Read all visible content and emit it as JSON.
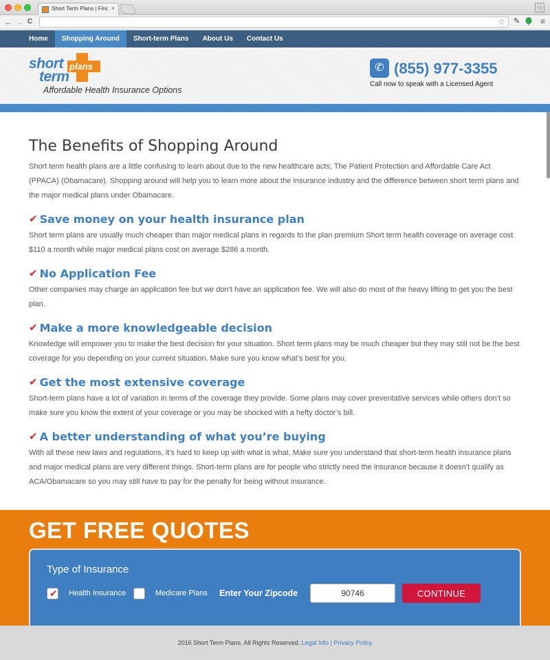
{
  "browser": {
    "tab_title": "Short Term Plans | Find the",
    "tab_close": "×",
    "back": "←",
    "forward": "→",
    "reload": "C",
    "star": "☆",
    "menu": "≡",
    "profile": "⚇"
  },
  "nav": {
    "items": [
      {
        "label": "Home"
      },
      {
        "label": "Shopping Around"
      },
      {
        "label": "Short-term Plans"
      },
      {
        "label": "About Us"
      },
      {
        "label": "Contact Us"
      }
    ],
    "active_index": 1
  },
  "header": {
    "logo_short": "short",
    "logo_term": "term",
    "logo_plans": "plans",
    "tagline": "Affordable Health Insurance Options",
    "phone_icon": "✆",
    "phone": "(855) 977-3355",
    "phone_caption": "Call now to speak with a Licensed Agent"
  },
  "content": {
    "title": "The Benefits of Shopping Around",
    "intro": "Short term health plans are a little confusing to learn about due to the new healthcare acts; The Patient Protection and Affordable Care Act (PPACA) (Obamacare). Shopping around will help you to learn more about the insurance industry and the difference between short term plans and the major medical plans under Obamacare.",
    "check_glyph": "✔",
    "benefits": [
      {
        "title": "Save money on your health insurance plan",
        "text": "Short term plans are usually much cheaper than major medical plans in regards to the plan premium Short term health coverage on average cost $110 a month while major medical plans cost on average $286 a month."
      },
      {
        "title": "No Application Fee",
        "text": "Other companies may charge an application fee but we don’t have an application fee. We will also do most of the heavy lifting to get you the best plan."
      },
      {
        "title": "Make a more knowledgeable decision",
        "text": "Knowledge will empower you to make the best decision for your situation. Short term plans may be much cheaper but they may still not be the best coverage for you depending on your current situation. Make sure you know what’s best for you."
      },
      {
        "title": "Get the most extensive coverage",
        "text": "Short-term plans have a lot of variation in terms of the coverage they provide. Some plans may cover preventative services while others don’t so make sure you know the extent of your coverage or you may be shocked with a hefty doctor’s bill."
      },
      {
        "title": "A better understanding of what you’re buying",
        "text": "With all these new laws and regulations, it’s hard to keep up with what is what. Make sure you understand that short-term health insurance plans and major medical plans are very different things. Short-term plans are for people who strictly need the insurance because it doesn’t qualify as ACA/Obamacare so you may still have to pay for the penalty for being without insurance."
      }
    ]
  },
  "quotes": {
    "title": "GET FREE QUOTES",
    "type_label": "Type of Insurance",
    "option_health": "Health Insurance",
    "option_health_checked": true,
    "option_medicare": "Medicare Plans",
    "option_medicare_checked": false,
    "zip_label": "Enter Your Zipcode",
    "zip_value": "90746",
    "continue_label": "CONTINUE"
  },
  "footer": {
    "copyright": "2016 Short Term Plans. All Rights Reserved.",
    "legal_link": "Legal Info",
    "separator": "|",
    "privacy_link": "Privacy Policy"
  },
  "colors": {
    "nav_bg": "#3c5e80",
    "accent_blue": "#3f7fc1",
    "accent_orange": "#e97e0e",
    "continue_red": "#d1163c",
    "check_red": "#d0282e"
  }
}
